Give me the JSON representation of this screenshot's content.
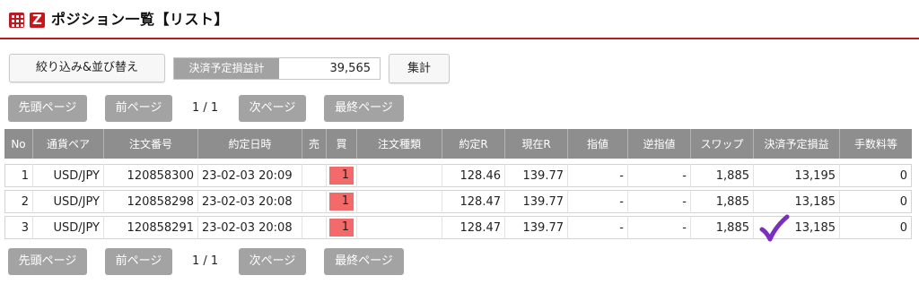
{
  "header": {
    "title": "ポジション一覧【リスト】",
    "grid_icon": "grid-menu-icon",
    "brand_icon": "z-logo-icon",
    "accent": "#b81c22"
  },
  "toolbar": {
    "filter_label": "絞り込み&並び替え",
    "pl_label": "決済予定損益計",
    "pl_value": "39,565",
    "total_label": "集計"
  },
  "pager": {
    "first": "先頭ページ",
    "prev": "前ページ",
    "info": "1 / 1",
    "next": "次ページ",
    "last": "最終ページ"
  },
  "table": {
    "columns": [
      "No",
      "通貨ペア",
      "注文番号",
      "約定日時",
      "売",
      "買",
      "注文種類",
      "約定R",
      "現在R",
      "指値",
      "逆指値",
      "スワップ",
      "決済予定損益",
      "手数料等"
    ],
    "rows": [
      {
        "no": "1",
        "pair": "USD/JPY",
        "order_no": "120858300",
        "datetime": "23-02-03 20:09",
        "sell": "",
        "buy": "1",
        "order_type": "",
        "exec_rate": "128.46",
        "current_rate": "139.77",
        "limit": "-",
        "stop": "-",
        "swap": "1,885",
        "pl": "13,195",
        "fee": "0"
      },
      {
        "no": "2",
        "pair": "USD/JPY",
        "order_no": "120858298",
        "datetime": "23-02-03 20:08",
        "sell": "",
        "buy": "1",
        "order_type": "",
        "exec_rate": "128.47",
        "current_rate": "139.77",
        "limit": "-",
        "stop": "-",
        "swap": "1,885",
        "pl": "13,185",
        "fee": "0"
      },
      {
        "no": "3",
        "pair": "USD/JPY",
        "order_no": "120858291",
        "datetime": "23-02-03 20:08",
        "sell": "",
        "buy": "1",
        "order_type": "",
        "exec_rate": "128.47",
        "current_rate": "139.77",
        "limit": "-",
        "stop": "-",
        "swap": "1,885",
        "pl": "13,185",
        "fee": "0"
      }
    ]
  },
  "colors": {
    "buy_highlight": "#f46a6a",
    "header_bg": "#8e8e8e",
    "pager_bg": "#a3a3a3",
    "checkmark": "#7b2fbf"
  }
}
